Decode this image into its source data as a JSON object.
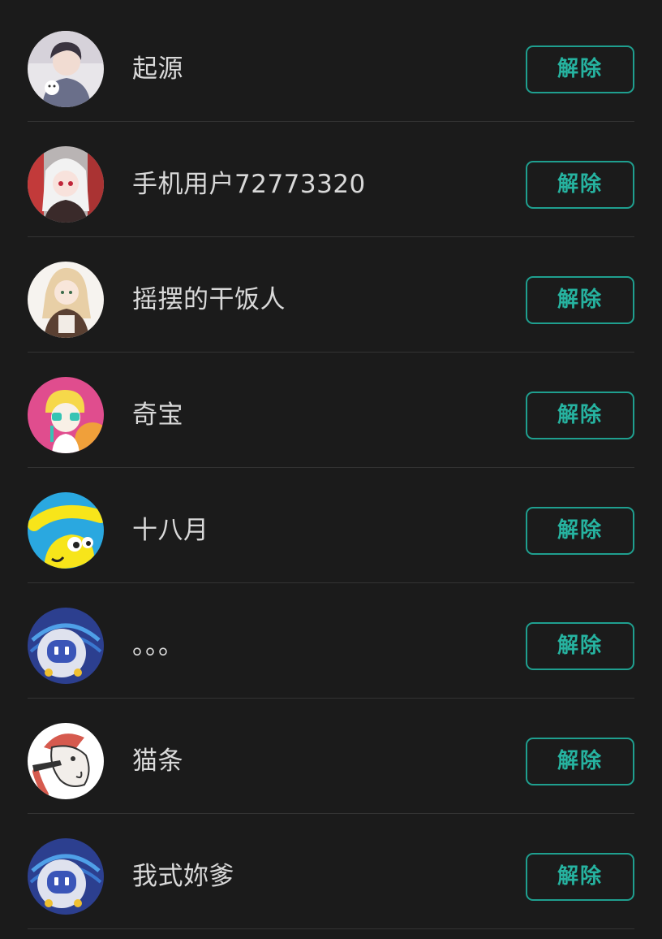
{
  "list": {
    "button_label": "解除",
    "divider_color": "#333333",
    "accent_color": "#26b3a0",
    "items": [
      {
        "name": "起源",
        "avatar": "anime-boy-with-cat-avatar"
      },
      {
        "name": "手机用户72773320",
        "avatar": "anime-girl-white-hair-avatar"
      },
      {
        "name": "摇摆的干饭人",
        "avatar": "anime-girl-blonde-maid-avatar"
      },
      {
        "name": "奇宝",
        "avatar": "pink-cartoon-character-avatar"
      },
      {
        "name": "十八月",
        "avatar": "cbeebies-logo-avatar"
      },
      {
        "name": "。。。",
        "avatar": "default-robot-avatar"
      },
      {
        "name": "猫条",
        "avatar": "cartoon-horse-avatar"
      },
      {
        "name": "我式妳爹",
        "avatar": "default-robot-avatar"
      }
    ]
  }
}
